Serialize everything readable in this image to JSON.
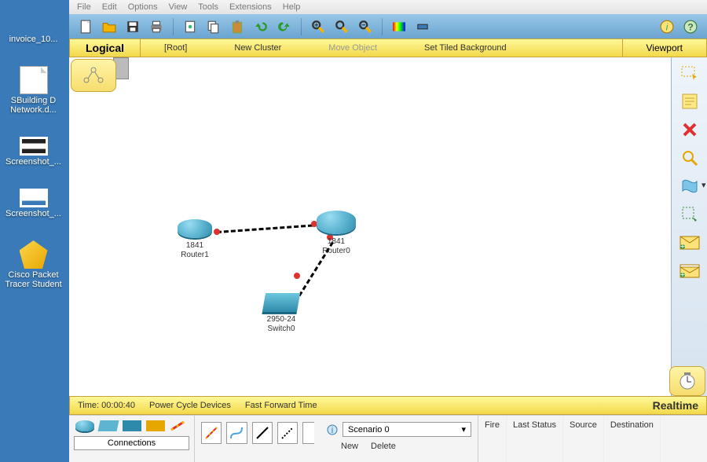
{
  "desktop": {
    "icons": [
      {
        "label": "invoice_10..."
      },
      {
        "label": "SBuilding D Network.d..."
      },
      {
        "label": "Screenshot_..."
      },
      {
        "label": "Screenshot_..."
      },
      {
        "label": "Cisco Packet Tracer Student"
      }
    ]
  },
  "menubar": [
    "File",
    "Edit",
    "Options",
    "View",
    "Tools",
    "Extensions",
    "Help"
  ],
  "toolbar_icons": [
    "new",
    "open",
    "save",
    "print",
    "copy",
    "paste",
    "undo",
    "redo",
    "zoom-in",
    "zoom-out",
    "zoom-reset",
    "palette",
    "layers",
    "info",
    "help"
  ],
  "topology_bar": {
    "active_tab": "Logical",
    "root": "[Root]",
    "items": [
      "New Cluster",
      "Move Object",
      "Set Tiled Background"
    ],
    "viewport": "Viewport"
  },
  "devices": {
    "router1": {
      "model": "1841",
      "name": "Router1"
    },
    "router0": {
      "model": "1841",
      "name": "Router0"
    },
    "switch0": {
      "model": "2950-24",
      "name": "Switch0"
    }
  },
  "palette_icons": [
    "marquee-select",
    "note",
    "delete",
    "inspect",
    "shape",
    "resize-area",
    "envelope-simple",
    "envelope-complex"
  ],
  "timebar": {
    "time_label": "Time:",
    "time_value": "00:00:40",
    "power": "Power Cycle Devices",
    "fft": "Fast Forward Time",
    "realtime": "Realtime"
  },
  "bottom": {
    "conn_label": "Connections",
    "scenario_label": "Scenario 0",
    "new_btn": "New",
    "delete_btn": "Delete",
    "pdu_headers": [
      "Fire",
      "Last Status",
      "Source",
      "Destination"
    ]
  },
  "colors": {
    "yellow": "#f2d94a",
    "cisco": "#5db5d1"
  }
}
